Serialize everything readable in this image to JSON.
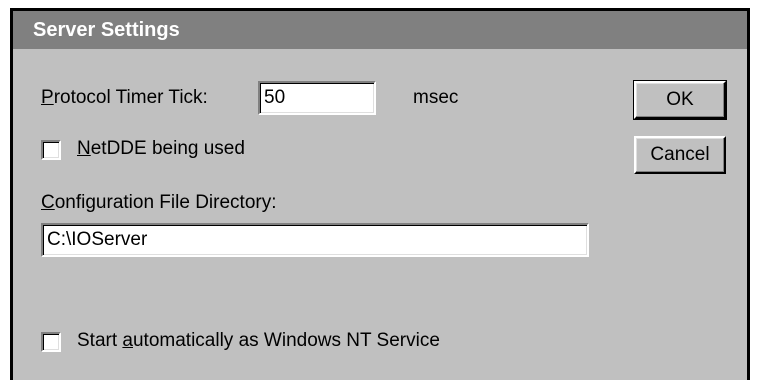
{
  "dialog": {
    "title": "Server Settings",
    "protocol_timer": {
      "label_access": "P",
      "label_rest": "rotocol Timer Tick:",
      "value": "50",
      "unit": "msec"
    },
    "netdde": {
      "label_access": "N",
      "label_rest": "etDDE being used",
      "checked": false
    },
    "config_dir": {
      "label_access": "C",
      "label_rest": "onfiguration File Directory:",
      "value": "C:\\IOServer"
    },
    "start_service": {
      "label_before": "Start ",
      "label_access": "a",
      "label_rest": "utomatically as Windows NT Service",
      "checked": false
    },
    "buttons": {
      "ok_label": "OK",
      "cancel_label": "Cancel"
    }
  },
  "colors": {
    "dialog_face": "#c0c0c0",
    "titlebar": "#808080",
    "title_text": "#ffffff"
  }
}
